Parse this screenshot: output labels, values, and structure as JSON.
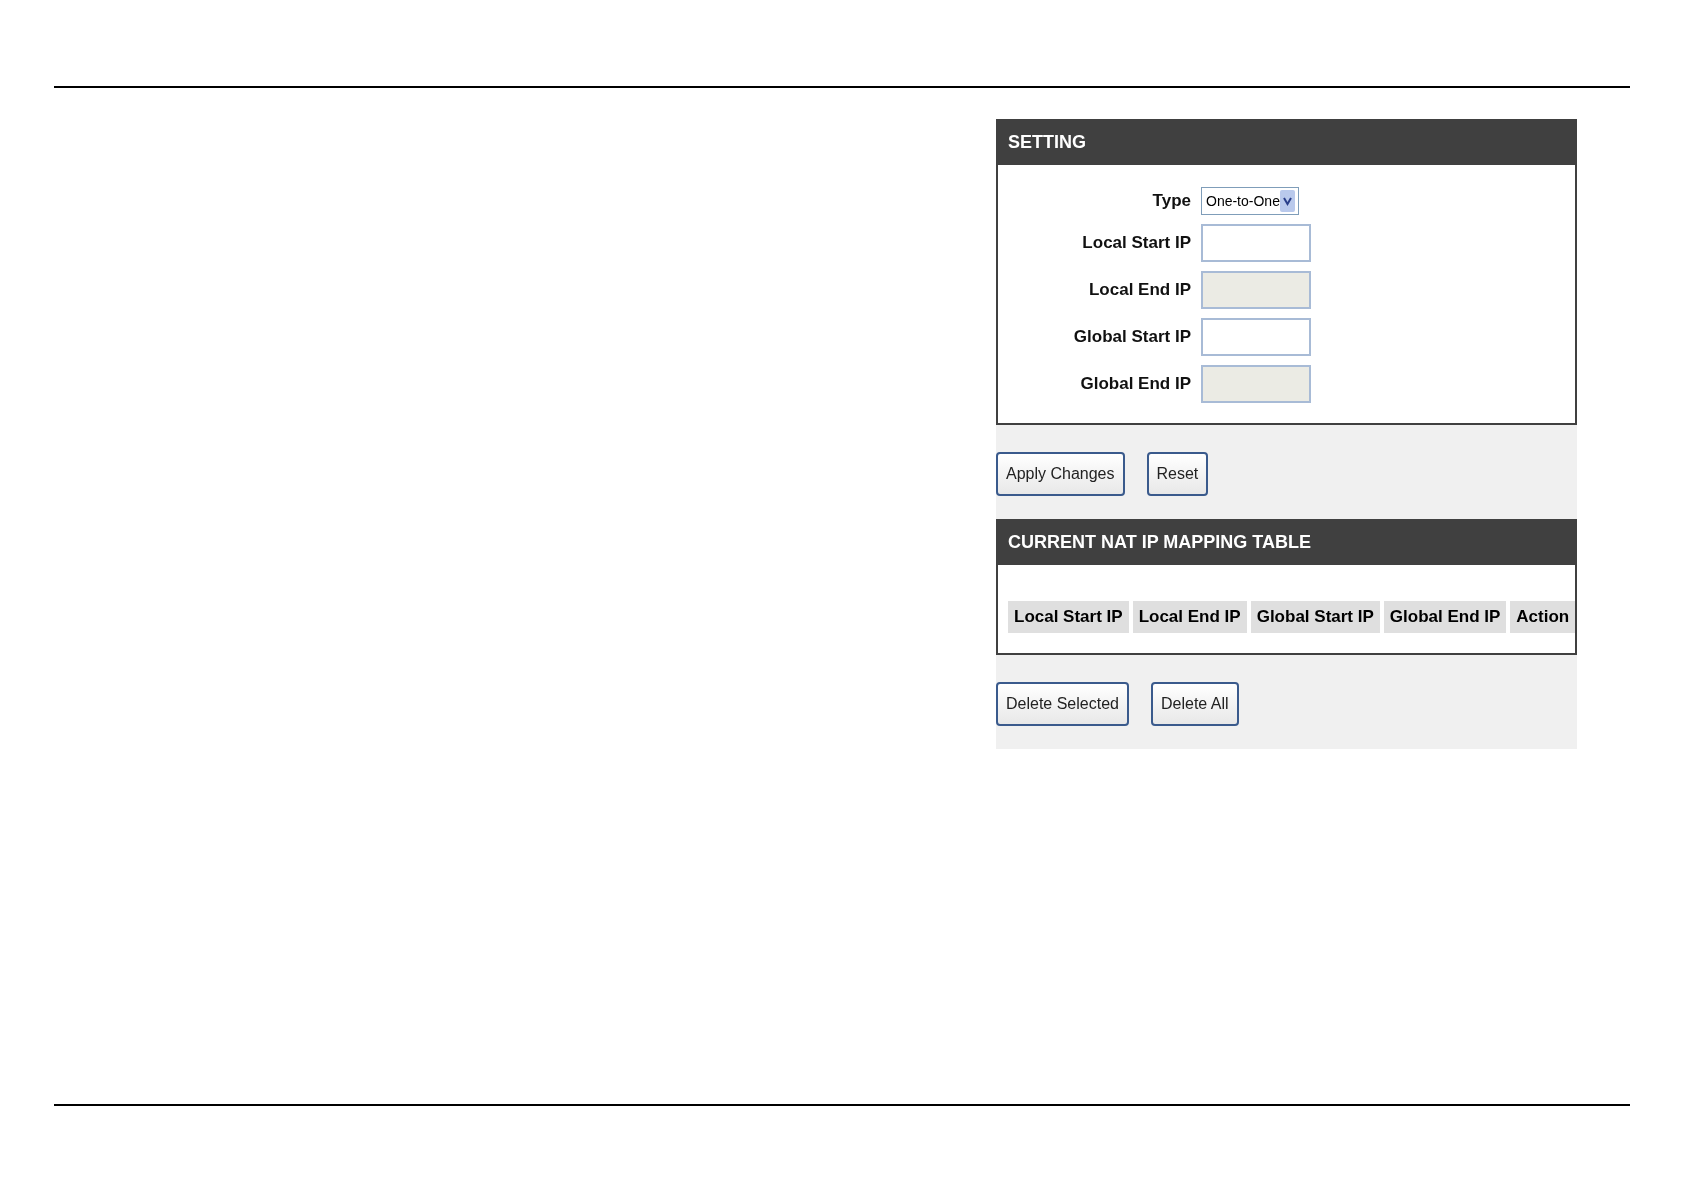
{
  "setting": {
    "title": "SETTING",
    "fields": [
      {
        "label": "Type",
        "kind": "select",
        "value": "One-to-One"
      },
      {
        "label": "Local Start IP",
        "kind": "text",
        "disabled": false
      },
      {
        "label": "Local End IP",
        "kind": "text",
        "disabled": true
      },
      {
        "label": "Global Start IP",
        "kind": "text",
        "disabled": false
      },
      {
        "label": "Global End IP",
        "kind": "text",
        "disabled": true
      }
    ]
  },
  "setting_buttons": [
    "Apply Changes",
    "Reset"
  ],
  "table": {
    "title": "CURRENT NAT IP MAPPING TABLE",
    "columns": [
      "Local Start IP",
      "Local End IP",
      "Global Start IP",
      "Global End IP",
      "Action"
    ]
  },
  "table_buttons": [
    "Delete Selected",
    "Delete All"
  ]
}
